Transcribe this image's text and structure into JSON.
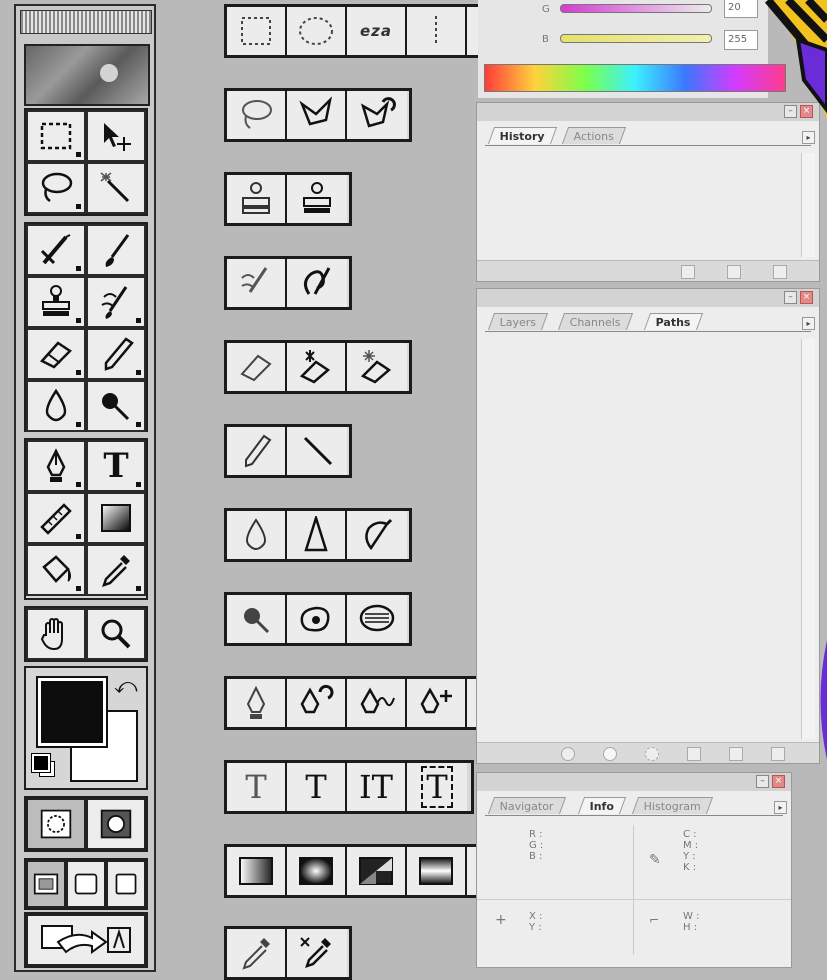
{
  "toolbox": {
    "type_tool_glyph": "T"
  },
  "expanded_rows": {
    "marquee_row_text": "eza",
    "type_row_letters": [
      "T",
      "T",
      "IT",
      "T"
    ]
  },
  "color_panel": {
    "g_label": "G",
    "g_value": "20",
    "b_label": "B",
    "b_value": "255"
  },
  "history_panel": {
    "tabs": [
      "History",
      "Actions"
    ],
    "active_tab": "History"
  },
  "layers_panel": {
    "tabs": [
      "Layers",
      "Channels",
      "Paths"
    ],
    "active_tab": "Paths"
  },
  "navigator_panel": {
    "tabs": [
      "Navigator",
      "Info",
      "Histogram"
    ],
    "active_tab": "Info",
    "rgb_labels": "R :\nG :\nB :",
    "cmyk_labels": "C :\nM :\nY :\nK :",
    "xy_labels": "X :\nY :",
    "wh_labels": "W :\nH :"
  },
  "colors": {
    "accent_purple": "#6a2bd8",
    "stripe_yellow": "#f2c21e"
  }
}
